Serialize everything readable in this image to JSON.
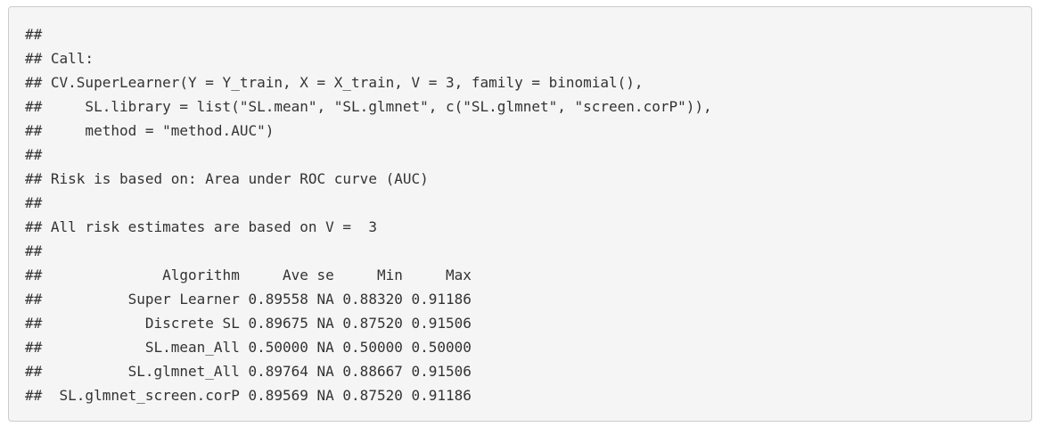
{
  "output": {
    "lines": [
      "##",
      "## Call:",
      "## CV.SuperLearner(Y = Y_train, X = X_train, V = 3, family = binomial(),",
      "##     SL.library = list(\"SL.mean\", \"SL.glmnet\", c(\"SL.glmnet\", \"screen.corP\")),",
      "##     method = \"method.AUC\")",
      "##",
      "## Risk is based on: Area under ROC curve (AUC)",
      "##",
      "## All risk estimates are based on V =  3",
      "##",
      "##              Algorithm     Ave se     Min     Max",
      "##          Super Learner 0.89558 NA 0.88320 0.91186",
      "##            Discrete SL 0.89675 NA 0.87520 0.91506",
      "##            SL.mean_All 0.50000 NA 0.50000 0.50000",
      "##          SL.glmnet_All 0.89764 NA 0.88667 0.91506",
      "##  SL.glmnet_screen.corP 0.89569 NA 0.87520 0.91186"
    ]
  }
}
